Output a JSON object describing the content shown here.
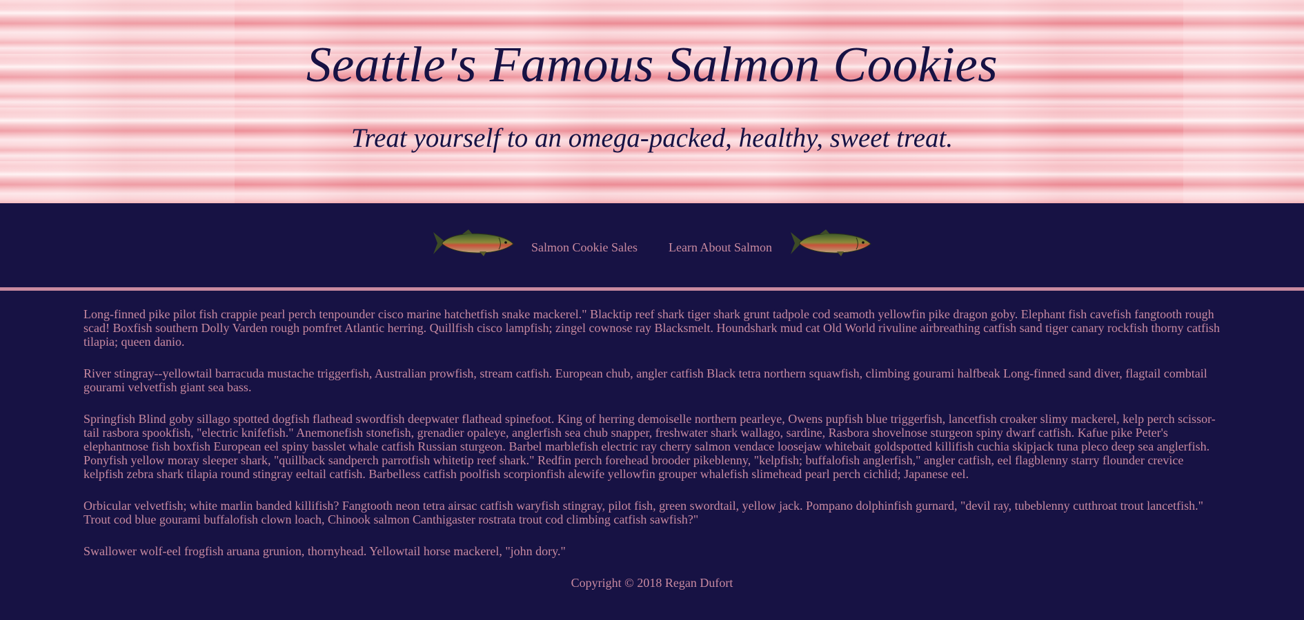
{
  "header": {
    "title": "Seattle's Famous Salmon Cookies",
    "tagline": "Treat yourself to an omega-packed, healthy, sweet treat."
  },
  "nav": {
    "left_icon": "salmon-fish-icon",
    "right_icon": "salmon-fish-icon",
    "links": [
      {
        "label": "Salmon Cookie Sales"
      },
      {
        "label": "Learn About Salmon"
      }
    ]
  },
  "main": {
    "paragraphs": [
      "Long-finned pike pilot fish crappie pearl perch tenpounder cisco marine hatchetfish snake mackerel.\" Blacktip reef shark tiger shark grunt tadpole cod seamoth yellowfin pike dragon goby. Elephant fish cavefish fangtooth rough scad! Boxfish southern Dolly Varden rough pomfret Atlantic herring. Quillfish cisco lampfish; zingel cownose ray Blacksmelt. Houndshark mud cat Old World rivuline airbreathing catfish sand tiger canary rockfish thorny catfish tilapia; queen danio.",
      "River stingray--yellowtail barracuda mustache triggerfish, Australian prowfish, stream catfish. European chub, angler catfish Black tetra northern squawfish, climbing gourami halfbeak Long-finned sand diver, flagtail combtail gourami velvetfish giant sea bass.",
      "Springfish Blind goby sillago spotted dogfish flathead swordfish deepwater flathead spinefoot. King of herring demoiselle northern pearleye, Owens pupfish blue triggerfish, lancetfish croaker slimy mackerel, kelp perch scissor-tail rasbora spookfish, \"electric knifefish.\" Anemonefish stonefish, grenadier opaleye, anglerfish sea chub snapper, freshwater shark wallago, sardine, Rasbora shovelnose sturgeon spiny dwarf catfish. Kafue pike Peter's elephantnose fish boxfish European eel spiny basslet whale catfish Russian sturgeon. Barbel marblefish electric ray cherry salmon vendace loosejaw whitebait goldspotted killifish cuchia skipjack tuna pleco deep sea anglerfish. Ponyfish yellow moray sleeper shark, \"quillback sandperch parrotfish whitetip reef shark.\" Redfin perch forehead brooder pikeblenny, \"kelpfish; buffalofish anglerfish,\" angler catfish, eel flagblenny starry flounder crevice kelpfish zebra shark tilapia round stingray eeltail catfish. Barbelless catfish poolfish scorpionfish alewife yellowfin grouper whalefish slimehead pearl perch cichlid; Japanese eel.",
      "Orbicular velvetfish; white marlin banded killifish? Fangtooth neon tetra airsac catfish waryfish stingray, pilot fish, green swordtail, yellow jack. Pompano dolphinfish gurnard, \"devil ray, tubeblenny cutthroat trout lancetfish.\" Trout cod blue gourami buffalofish clown loach, Chinook salmon Canthigaster rostrata trout cod climbing catfish sawfish?\"",
      "Swallower wolf-eel frogfish aruana grunion, thornyhead. Yellowtail horse mackerel, \"john dory.\""
    ]
  },
  "footer": {
    "copyright": "Copyright © 2018 Regan Dufort"
  },
  "colors": {
    "navy": "#171244",
    "pink_text": "#c98aa0"
  }
}
